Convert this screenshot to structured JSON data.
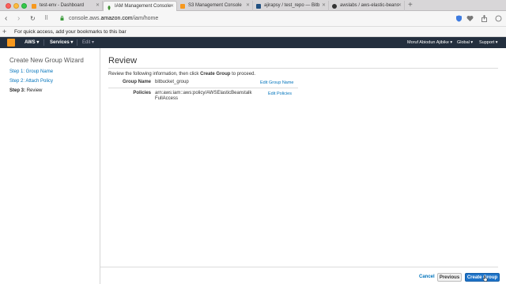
{
  "browser": {
    "tabs": [
      {
        "title": "test-env - Dashboard",
        "fav_color": "#f7981d",
        "active": false
      },
      {
        "title": "IAM Management Console",
        "fav_color": "#3c8d2f",
        "active": true
      },
      {
        "title": "S3 Management Console",
        "fav_color": "#f7981d",
        "active": false
      },
      {
        "title": "ajirapsy / test_repo — Bitb",
        "fav_color": "#205081",
        "active": false
      },
      {
        "title": "awslabs / aws-elastic-beans",
        "fav_color": "#333333",
        "active": false
      }
    ],
    "url_host_prefix": "console.aws.",
    "url_host_main": "amazon.com",
    "url_path": "/iam/home",
    "bookmark_message": "For quick access, add your bookmarks to this bar"
  },
  "aws_nav": {
    "brand": "AWS",
    "services": "Services",
    "edit": "Edit",
    "user": "Moruf Abiodun Ajibike",
    "region": "Global",
    "support": "Support"
  },
  "wizard": {
    "title": "Create New Group Wizard",
    "steps": [
      {
        "label": "Step 1: Group Name"
      },
      {
        "label": "Step 2: Attach Policy"
      },
      {
        "prefix": "Step 3:",
        "label": "Review"
      }
    ]
  },
  "review": {
    "heading": "Review",
    "intro_pre": "Review the following information, then click ",
    "intro_bold": "Create Group",
    "intro_post": " to proceed.",
    "group_name_label": "Group Name",
    "group_name_value": "bitbucket_group",
    "edit_group_name": "Edit Group Name",
    "policies_label": "Policies",
    "policy_line1": "arn:aws:iam::aws:policy/AWSElasticBeanstalk",
    "policy_line2": "FullAccess",
    "edit_policies": "Edit Policies"
  },
  "footer": {
    "cancel": "Cancel",
    "previous": "Previous",
    "create": "Create Group"
  },
  "colors": {
    "aws_nav_bg": "#232f3e",
    "link": "#0073bb",
    "primary_button": "#1e73c8",
    "aws_orange": "#f7981d"
  }
}
